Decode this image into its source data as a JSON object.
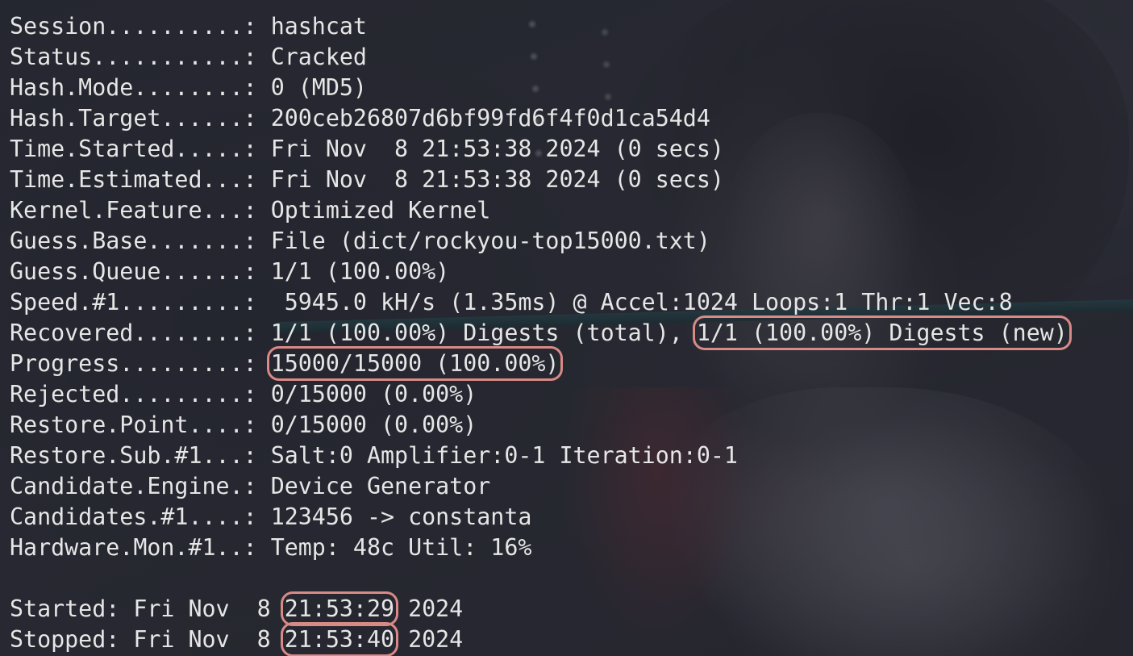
{
  "stats": [
    {
      "key": "Session..........",
      "value": "hashcat"
    },
    {
      "key": "Status...........",
      "value": "Cracked"
    },
    {
      "key": "Hash.Mode........",
      "value": "0 (MD5)"
    },
    {
      "key": "Hash.Target......",
      "value": "200ceb26807d6bf99fd6f4f0d1ca54d4"
    },
    {
      "key": "Time.Started.....",
      "value": "Fri Nov  8 21:53:38 2024 (0 secs)"
    },
    {
      "key": "Time.Estimated...",
      "value": "Fri Nov  8 21:53:38 2024 (0 secs)"
    },
    {
      "key": "Kernel.Feature...",
      "value": "Optimized Kernel"
    },
    {
      "key": "Guess.Base.......",
      "value": "File (dict/rockyou-top15000.txt)"
    },
    {
      "key": "Guess.Queue......",
      "value": "1/1 (100.00%)"
    },
    {
      "key": "Speed.#1.........",
      "value": " 5945.0 kH/s (1.35ms) @ Accel:1024 Loops:1 Thr:1 Vec:8"
    },
    {
      "key": "Recovered........",
      "value": "1/1 (100.00%) Digests (total), ",
      "highlight": "1/1 (100.00%) Digests (new)"
    },
    {
      "key": "Progress.........",
      "value": "",
      "highlight": "15000/15000 (100.00%)"
    },
    {
      "key": "Rejected.........",
      "value": "0/15000 (0.00%)"
    },
    {
      "key": "Restore.Point....",
      "value": "0/15000 (0.00%)"
    },
    {
      "key": "Restore.Sub.#1...",
      "value": "Salt:0 Amplifier:0-1 Iteration:0-1"
    },
    {
      "key": "Candidate.Engine.",
      "value": "Device Generator"
    },
    {
      "key": "Candidates.#1....",
      "value": "123456 -> constanta"
    },
    {
      "key": "Hardware.Mon.#1..",
      "value": "Temp: 48c Util: 16%"
    }
  ],
  "separator": ": ",
  "summary": {
    "started": {
      "prefix": "Started: Fri Nov  8 ",
      "time": "21:53:29",
      "suffix": " 2024"
    },
    "stopped": {
      "prefix": "Stopped: Fri Nov  8 ",
      "time": "21:53:40",
      "suffix": " 2024"
    }
  },
  "colors": {
    "text": "#e6e6e6",
    "highlight_border": "#d88a86",
    "background": "#2a2d36"
  }
}
